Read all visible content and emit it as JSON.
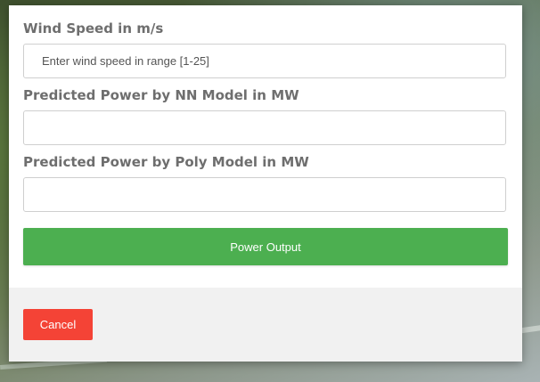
{
  "form": {
    "wind_speed_label": "Wind Speed in m/s",
    "wind_speed_placeholder": "Enter wind speed in range [1-25]",
    "wind_speed_value": "",
    "nn_power_label": "Predicted Power by NN Model in MW",
    "nn_power_value": "",
    "poly_power_label": "Predicted Power by Poly Model in MW",
    "poly_power_value": "",
    "submit_label": "Power Output"
  },
  "footer": {
    "cancel_label": "Cancel"
  },
  "colors": {
    "primary_button": "#4caf50",
    "cancel_button": "#f44336",
    "footer_background": "#f1f1f1",
    "label_text": "#6e6e6e"
  }
}
